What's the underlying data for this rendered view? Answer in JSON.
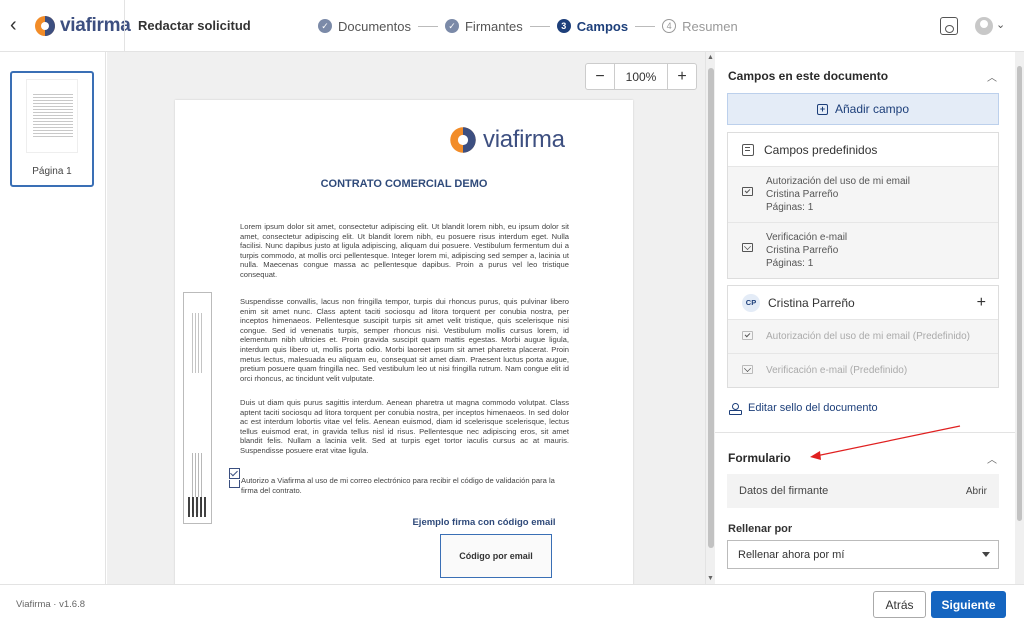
{
  "header": {
    "brand": "viafirma",
    "title": "Redactar solicitud",
    "steps": [
      {
        "num": "✓",
        "label": "Documentos",
        "state": "done"
      },
      {
        "num": "✓",
        "label": "Firmantes",
        "state": "done"
      },
      {
        "num": "3",
        "label": "Campos",
        "state": "current"
      },
      {
        "num": "4",
        "label": "Resumen",
        "state": "pending"
      }
    ],
    "icons": [
      "back-arrow-icon",
      "save-icon",
      "user-avatar-icon",
      "chevron-down-icon"
    ]
  },
  "thumbnails": [
    {
      "label": "Página 1"
    }
  ],
  "viewer": {
    "zoom_minus": "−",
    "zoom_value": "100%",
    "zoom_plus": "+"
  },
  "document": {
    "brand": "viafirma",
    "title": "CONTRATO COMERCIAL DEMO",
    "paragraphs": [
      "Lorem ipsum dolor sit amet, consectetur adipiscing elit. Ut blandit lorem nibh, eu ipsum dolor sit amet, consectetur adipiscing elit. Ut blandit lorem nibh, eu posuere risus interdum eget. Nulla facilisi. Nunc dapibus justo at ligula adipiscing, aliquam dui posuere. Vestibulum fermentum dui a turpis commodo, at mollis orci pellentesque. Integer lorem mi, adipiscing sed semper a, lacinia ut nulla. Maecenas congue massa ac pellentesque dapibus. Proin a purus vel leo tristique consequat.",
      "Suspendisse convallis, lacus non fringilla tempor, turpis dui rhoncus purus, quis pulvinar libero enim sit amet nunc. Class aptent taciti sociosqu ad litora torquent per conubia nostra, per inceptos himenaeos. Pellentesque suscipit turpis sit amet velit tristique, quis scelerisque nisi congue. Sed id venenatis turpis, semper rhoncus nisi. Vestibulum mollis cursus lorem, id elementum nibh ultricies et. Proin gravida suscipit quam mattis egestas. Morbi augue ligula, interdum quis libero ut, mollis porta odio. Morbi laoreet ipsum sit amet pharetra placerat. Proin metus lectus, malesuada eu aliquam eu, consequat sit amet diam. Praesent luctus porta augue, pretium posuere quam fringilla nec. Sed vestibulum leo ut nisi fringilla rutrum. Nam congue elit id orci rhoncus, ac tincidunt velit vulputate.",
      "Duis ut diam quis purus sagittis interdum. Aenean pharetra ut magna commodo volutpat. Class aptent taciti sociosqu ad litora torquent per conubia nostra, per inceptos himenaeos. In sed dolor ac est interdum lobortis vitae vel felis. Aenean euismod, diam id scelerisque scelerisque, lectus tellus euismod erat, in gravida tellus nisl id risus. Pellentesque nec adipiscing eros, sit amet blandit felis. Nullam a lacinia velit. Sed at turpis eget tortor iaculis cursus ac at mauris. Suspendisse posuere erat vitae ligula."
    ],
    "consent": "Autorizo a Viafirma al uso de mi correo electrónico para recibir el código de validación para la firma del contrato.",
    "signature_label": "Ejemplo firma con código email",
    "signature_box": "Código por email"
  },
  "panel": {
    "fields_section_title": "Campos en este documento",
    "add_field": "Añadir campo",
    "predefined": {
      "title": "Campos predefinidos",
      "items": [
        {
          "name": "Autorización del uso de mi email",
          "signer": "Cristina Parreño",
          "pages": "Páginas: 1",
          "icon": "checkbox-icon"
        },
        {
          "name": "Verificación e-mail",
          "signer": "Cristina Parreño",
          "pages": "Páginas: 1",
          "icon": "mail-icon"
        }
      ]
    },
    "signer_card": {
      "initials": "CP",
      "name": "Cristina Parreño",
      "add": "+",
      "items": [
        {
          "label": "Autorización del uso de mi email (Predefinido)",
          "icon": "checkbox-icon"
        },
        {
          "label": "Verificación e-mail (Predefinido)",
          "icon": "mail-icon"
        }
      ]
    },
    "edit_stamp": "Editar sello del documento",
    "form_section_title": "Formulario",
    "signer_data": "Datos del firmante",
    "open": "Abrir",
    "fill_by_label": "Rellenar por",
    "fill_by_value": "Rellenar ahora por mí"
  },
  "footer": {
    "version": "Viafirma  ·  v1.6.8",
    "back": "Atrás",
    "next": "Siguiente"
  },
  "colors": {
    "accent": "#1565c0",
    "brand_dark": "#1d3f7a",
    "logo_orange": "#f28c28",
    "annotation_arrow": "#e02020"
  }
}
